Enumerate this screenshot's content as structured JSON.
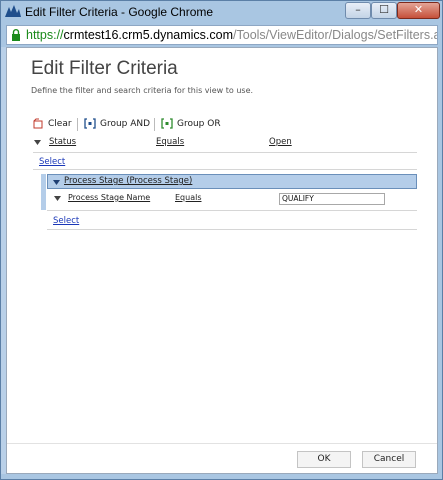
{
  "window": {
    "title": "Edit Filter Criteria - Google Chrome",
    "controls": {
      "minimize": "–",
      "maximize": "☐",
      "close": "✕"
    }
  },
  "address": {
    "scheme": "https://",
    "host": "crmtest16.crm5.dynamics.com",
    "path": "/Tools/ViewEditor/Dialogs/SetFilters.aspx?ap"
  },
  "dialog": {
    "heading": "Edit Filter Criteria",
    "description": "Define the filter and search criteria for this view to use."
  },
  "toolbar": {
    "clear": "Clear",
    "group_and": "Group AND",
    "group_or": "Group OR"
  },
  "filter": {
    "row1": {
      "field": "Status",
      "operator": "Equals",
      "value": "Open"
    },
    "select1": "Select",
    "group": {
      "label": "Process Stage (Process Stage)"
    },
    "row2": {
      "field": "Process Stage Name",
      "operator": "Equals",
      "value": "QUALIFY"
    },
    "select2": "Select"
  },
  "footer": {
    "ok": "OK",
    "cancel": "Cancel"
  },
  "colors": {
    "accent": "#b4cde9",
    "window_frame": "#a9c6e2"
  }
}
